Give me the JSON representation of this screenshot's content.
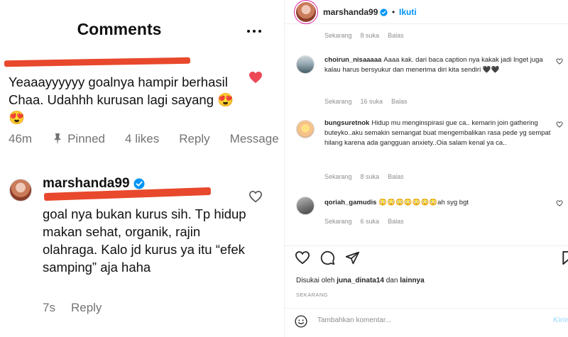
{
  "left": {
    "title": "Comments",
    "comment1": {
      "text": "Yeaaayyyyyy goalnya hampir berhasil Chaa. Udahhh kurusan lagi sayang 😍😍",
      "time": "46m",
      "pinned": "Pinned",
      "likes": "4 likes",
      "reply": "Reply",
      "message": "Message"
    },
    "comment2": {
      "username": "marshanda99",
      "text": "goal nya bukan kurus sih. Tp hidup makan sehat, organik, rajin olahraga. Kalo jd kurus ya itu “efek samping” aja haha",
      "time": "7s",
      "reply": "Reply"
    }
  },
  "right": {
    "header": {
      "username": "marshanda99",
      "separator": "•",
      "follow": "Ikuti"
    },
    "top_meta": {
      "time": "Sekarang",
      "likes": "8 suka",
      "reply": "Balas"
    },
    "comments": [
      {
        "username": "choirun_nisaaaaa",
        "text": "Aaaa kak. dari baca caption nya kakak jadi Inget juga kalau harus bersyukur dan menerima diri kita sendiri 🖤🖤",
        "time": "Sekarang",
        "likes": "16 suka",
        "reply": "Balas"
      },
      {
        "username": "bungsuretnok",
        "text": "Hidup mu menginspirasi gue ca.. kemarin join gathering buteyko..aku semakin semangat buat mengembalikan rasa pede yg sempat hilang karena ada gangguan anxiety..Oia salam kenal ya ca..",
        "time": "Sekarang",
        "likes": "8 suka",
        "reply": "Balas"
      },
      {
        "username": "qoriah_gamudis",
        "text": "😳😳😳😳😳😳😳ah syg bgt",
        "time": "Sekarang",
        "likes": "6 suka",
        "reply": "Balas"
      }
    ],
    "likes_line": {
      "prefix": "Disukai oleh",
      "user": "juna_dinata14",
      "conj": "dan",
      "others": "lainnya"
    },
    "date": "SEKARANG",
    "add_comment": {
      "placeholder": "Tambahkan komentar...",
      "post": "Kirim"
    }
  },
  "colors": {
    "blue": "#0095f6",
    "heart_red": "#ed4956",
    "redaction": "#e8482c",
    "muted": "#8e8e8e"
  }
}
